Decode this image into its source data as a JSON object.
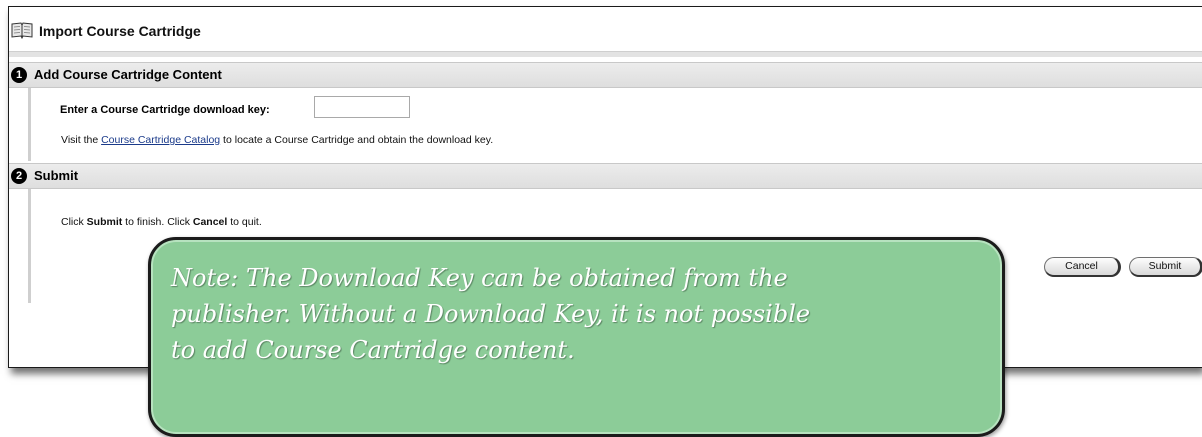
{
  "header": {
    "title": "Import Course Cartridge",
    "icon": "book-icon"
  },
  "steps": [
    {
      "number": "1",
      "title": "Add Course Cartridge Content"
    },
    {
      "number": "2",
      "title": "Submit"
    }
  ],
  "step1": {
    "field_label": "Enter a Course Cartridge download key:",
    "input_value": "",
    "help_prefix": "Visit the ",
    "help_link": "Course Cartridge Catalog",
    "help_suffix": " to locate a Course Cartridge and obtain the download key."
  },
  "step2": {
    "instr_part1": "Click ",
    "instr_submit": "Submit",
    "instr_part2": " to finish. Click ",
    "instr_cancel": "Cancel",
    "instr_part3": " to quit."
  },
  "buttons": {
    "cancel": "Cancel",
    "submit": "Submit"
  },
  "callout": {
    "text": " Note: The Download Key can be obtained from the\npublisher. Without a Download Key, it is not possible\nto add Course Cartridge content.",
    "color": "#8ccc98"
  }
}
